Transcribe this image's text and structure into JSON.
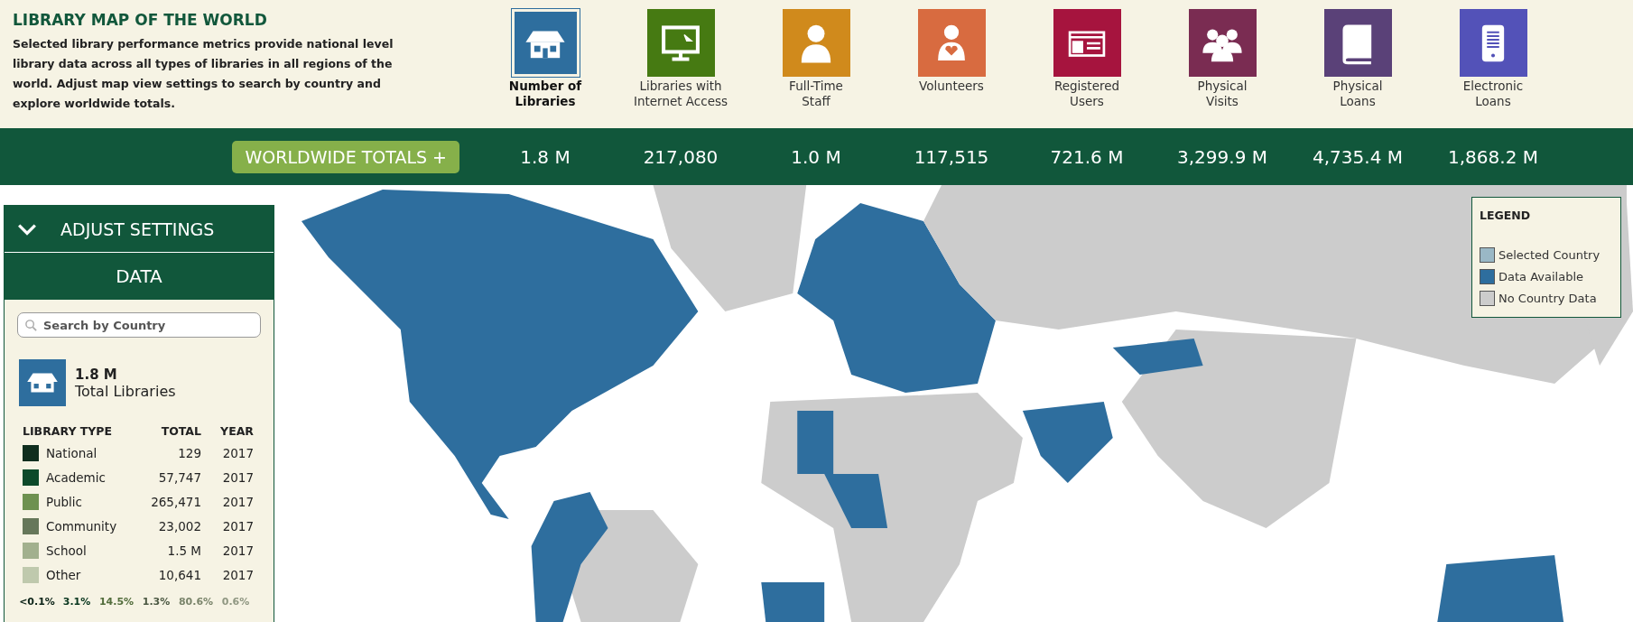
{
  "header": {
    "title": "LIBRARY MAP OF THE WORLD",
    "description": "Selected library performance metrics provide national level library data across all types of libraries in all regions of the world. Adjust map view settings to search by country and explore worldwide totals."
  },
  "metrics": [
    {
      "kind": "house",
      "label": "Number of\nLibraries",
      "value": "1.8 M",
      "color": "#2e6e9e",
      "selected": true
    },
    {
      "kind": "monitor",
      "label": "Libraries with\nInternet Access",
      "value": "217,080",
      "color": "#467a12",
      "selected": false
    },
    {
      "kind": "person",
      "label": "Full-Time\nStaff",
      "value": "1.0 M",
      "color": "#d08a1c",
      "selected": false
    },
    {
      "kind": "volunteer",
      "label": "Volunteers",
      "value": "117,515",
      "color": "#d86b40",
      "selected": false
    },
    {
      "kind": "card",
      "label": "Registered\nUsers",
      "value": "721.6 M",
      "color": "#a6143e",
      "selected": false
    },
    {
      "kind": "group",
      "label": "Physical\nVisits",
      "value": "3,299.9 M",
      "color": "#7a2c52",
      "selected": false
    },
    {
      "kind": "book",
      "label": "Physical\nLoans",
      "value": "4,735.4 M",
      "color": "#5a4178",
      "selected": false
    },
    {
      "kind": "tablet",
      "label": "Electronic\nLoans",
      "value": "1,868.2 M",
      "color": "#5352b8",
      "selected": false
    }
  ],
  "totals_button": "WORLDWIDE TOTALS +",
  "sidebar": {
    "settings_label": "ADJUST SETTINGS",
    "data_tab": "DATA",
    "search": {
      "placeholder": "Search by Country"
    },
    "summary": {
      "value": "1.8 M",
      "label": "Total Libraries"
    },
    "columns": [
      "LIBRARY TYPE",
      "TOTAL",
      "YEAR"
    ],
    "rows": [
      {
        "type": "National",
        "total": "129",
        "year": "2017",
        "color": "#0f2e1e"
      },
      {
        "type": "Academic",
        "total": "57,747",
        "year": "2017",
        "color": "#0d4a2a"
      },
      {
        "type": "Public",
        "total": "265,471",
        "year": "2017",
        "color": "#6e9150"
      },
      {
        "type": "Community",
        "total": "23,002",
        "year": "2017",
        "color": "#66775a"
      },
      {
        "type": "School",
        "total": "1.5 M",
        "year": "2017",
        "color": "#a2b08e"
      },
      {
        "type": "Other",
        "total": "10,641",
        "year": "2017",
        "color": "#bfc9ad"
      }
    ],
    "share_labels": [
      {
        "text": "<0.1%",
        "color": "#0f2e1e"
      },
      {
        "text": "3.1%",
        "color": "#0d4a2a"
      },
      {
        "text": "14.5%",
        "color": "#6e9150"
      },
      {
        "text": "1.3%",
        "color": "#66775a"
      },
      {
        "text": "80.6%",
        "color": "#a2b08e"
      },
      {
        "text": "0.6%",
        "color": "#bfc9ad"
      }
    ]
  },
  "legend": {
    "title": "LEGEND",
    "items": [
      {
        "label": "Selected Country",
        "color": "#9ab8c6"
      },
      {
        "label": "Data Available",
        "color": "#2e6e9e"
      },
      {
        "label": "No Country Data",
        "color": "#cccccc"
      }
    ]
  }
}
